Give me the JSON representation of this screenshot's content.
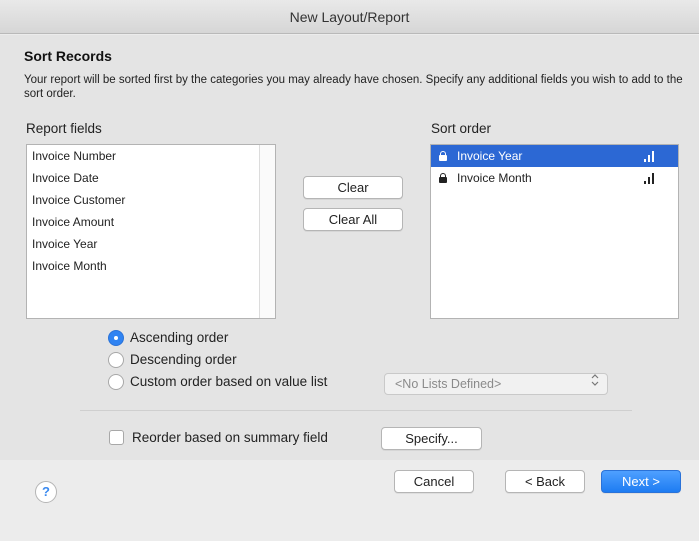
{
  "window": {
    "title": "New Layout/Report"
  },
  "section": {
    "title": "Sort Records",
    "description": "Your report will be sorted first by the categories you may already have chosen. Specify any additional fields you wish to add to the sort order."
  },
  "report_fields": {
    "label": "Report fields",
    "items": [
      "Invoice Number",
      "Invoice Date",
      "Invoice Customer",
      "Invoice Amount",
      "Invoice Year",
      "Invoice Month"
    ]
  },
  "buttons": {
    "clear": "Clear",
    "clear_all": "Clear All",
    "specify": "Specify...",
    "cancel": "Cancel",
    "back": "< Back",
    "next": "Next >"
  },
  "sort_order": {
    "label": "Sort order",
    "items": [
      {
        "label": "Invoice Year",
        "selected": true
      },
      {
        "label": "Invoice Month",
        "selected": false
      }
    ]
  },
  "order_options": {
    "ascending": "Ascending order",
    "descending": "Descending order",
    "custom": "Custom order based on value list",
    "selected": "ascending",
    "value_list": "<No Lists Defined>"
  },
  "summary": {
    "label": "Reorder based on summary field",
    "checked": false
  },
  "help": {
    "glyph": "?"
  },
  "icons": {
    "chevron": "⌃⌄"
  },
  "colors": {
    "accent": "#2c68d4",
    "primary_button": "#1d7cf2"
  }
}
